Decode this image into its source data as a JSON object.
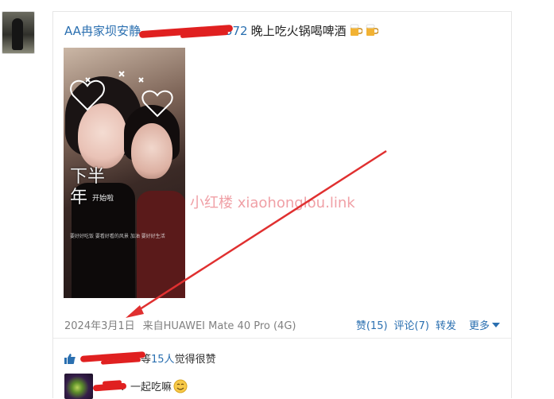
{
  "post": {
    "username": "AA冉家坝安静",
    "username_suffix": "572",
    "text": "晚上吃火锅喝啤酒",
    "emojis": [
      "beer-mug-icon",
      "beer-mug-icon"
    ],
    "image": {
      "overlay_title_line1": "下半",
      "overlay_title_line2": "年",
      "overlay_small": "开始啦",
      "overlay_caption": "要好好吃饭 要看好看的风景 加油 要好好生活"
    },
    "date": "2024年3月1日",
    "source": "来自HUAWEI Mate 40 Pro (4G)"
  },
  "actions": {
    "like": "赞(15)",
    "comment": "评论(7)",
    "forward": "转发",
    "more": "更多"
  },
  "likes_line": {
    "prefix": "等",
    "count": "15人",
    "suffix": "觉得很赞"
  },
  "comment": {
    "text": "：一起吃嘛",
    "emoji": "sly-grin-icon"
  },
  "watermark": "小红楼  xiaohonglou.link",
  "colors": {
    "link": "#2a6fb0",
    "redaction": "#e02020",
    "arrow": "#e03030",
    "watermark": "#f0a0a6"
  }
}
